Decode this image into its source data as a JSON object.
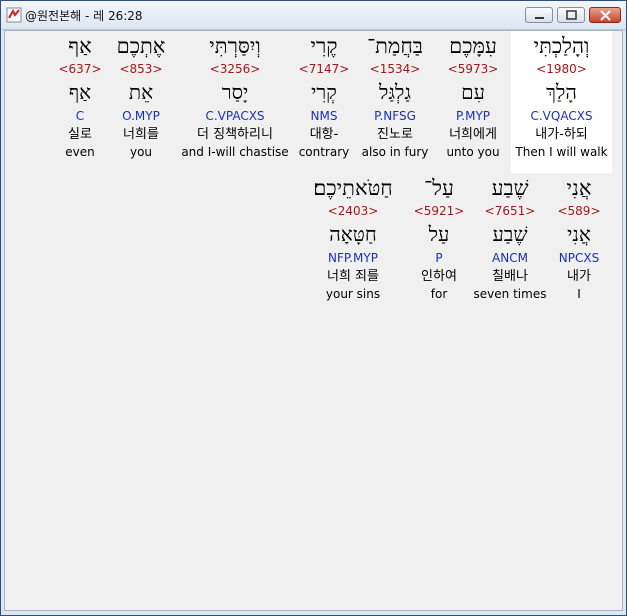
{
  "window": {
    "title": "@원전본해 - 레 26:28",
    "icon": "app-logo-icon",
    "accent": "#c8432b"
  },
  "verse": {
    "row1": [
      {
        "heb": "וְהָלַכְתִּי",
        "strong": "<1980>",
        "lemma": "הָלַךְ",
        "morph": "C.VQACXS",
        "kor": "내가-하되",
        "eng": "Then I will walk",
        "highlight": true
      },
      {
        "heb": "עִמָּכֶם",
        "strong": "<5973>",
        "lemma": "עִם",
        "morph": "P.MYP",
        "kor": "너희에게",
        "eng": "unto you"
      },
      {
        "heb": "בַּחֲמַת־",
        "strong": "<1534>",
        "lemma": "גַלְגַּל",
        "morph": "P.NFSG",
        "kor": "진노로",
        "eng": "also in fury"
      },
      {
        "heb": "קֶרִי",
        "strong": "<7147>",
        "lemma": "קְרִי",
        "morph": "NMS",
        "kor": "대항-",
        "eng": "contrary"
      },
      {
        "heb": "וְיִסַּרְתִּי",
        "strong": "<3256>",
        "lemma": "יָסַר",
        "morph": "C.VPACXS",
        "kor": "더 징책하리니",
        "eng": "and I-will chastise"
      },
      {
        "heb": "אֶתְכֶם",
        "strong": "<853>",
        "lemma": "אֵת",
        "morph": "O.MYP",
        "kor": "너희를",
        "eng": "you"
      },
      {
        "heb": "אַף",
        "strong": "<637>",
        "lemma": "אַף",
        "morph": "C",
        "kor": "실로",
        "eng": "even"
      }
    ],
    "row2": [
      {
        "heb": "אֲנִי",
        "strong": "<589>",
        "lemma": "אֲנִי",
        "morph": "NPCXS",
        "kor": "내가",
        "eng": "I"
      },
      {
        "heb": "שֶׁבַע",
        "strong": "<7651>",
        "lemma": "שֶׁבַע",
        "morph": "ANCM",
        "kor": "칠배나",
        "eng": "seven times"
      },
      {
        "heb": "עַל־",
        "strong": "<5921>",
        "lemma": "עַל",
        "morph": "P",
        "kor": "인하여",
        "eng": "for"
      },
      {
        "heb": "חַטֹּאתֵיכֶם׃",
        "strong": "<2403>",
        "lemma": "חַטָּאָה",
        "morph": "NFP.MYP",
        "kor": "너희 죄를",
        "eng": "your sins"
      }
    ]
  }
}
